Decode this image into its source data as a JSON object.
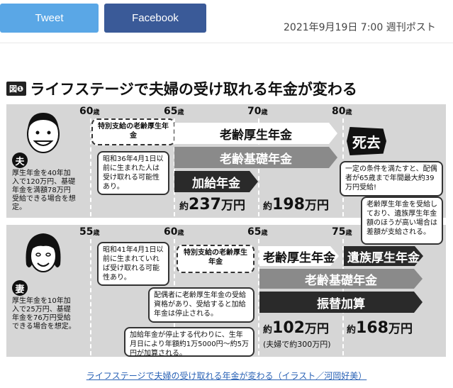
{
  "share": {
    "tweet_label": "Tweet",
    "facebook_label": "Facebook"
  },
  "meta": {
    "date": "2021年9月19日 7:00",
    "source": "週刊ポスト"
  },
  "figure": {
    "number": "図❶",
    "title": "ライフステージで夫婦の受け取れる年金が変わる",
    "husband": {
      "badge": "夫",
      "description": "厚生年金を40年加入で120万円、基礎年金を満額78万円受給できる場合を想定。",
      "ages": [
        "60",
        "65",
        "70",
        "80"
      ],
      "age_unit": "歳",
      "special_pension": "特別支給の老齢厚生年金",
      "note_special": "昭和36年4月1日以前に生まれた人は受け取れる可能性あり。",
      "bars": {
        "kousei": "老齢厚生年金",
        "kiso": "老齢基礎年金",
        "kakyu": "加給年金"
      },
      "death": "死去",
      "note_death": "一定の条件を満たすと、配偶者が65歳まで年間最大約39万円受給!",
      "amounts": [
        {
          "pre": "約",
          "big": "237",
          "unit": "万円"
        },
        {
          "pre": "約",
          "big": "198",
          "unit": "万円"
        }
      ]
    },
    "wife": {
      "badge": "妻",
      "description": "厚生年金を10年加入で25万円、基礎年金を76万円受給できる場合を想定。",
      "ages": [
        "55",
        "60",
        "65",
        "75"
      ],
      "age_unit": "歳",
      "special_pension": "特別支給の老齢厚生年金",
      "note_special": "昭和41年4月1日以前に生まれていれば受け取れる可能性あり。",
      "note_suspend": "配偶者に老齢厚生年金の受給資格があり、受給すると加給年金は停止される。",
      "note_furikae": "加給年金が停止する代わりに、生年月日により年額約1万5000円～約5万円が加算される。",
      "note_survivor": "老齢厚生年金を受給しており、遺族厚生年金額のほうが高い場合は差額が支給される。",
      "bars": {
        "kousei": "老齢厚生年金",
        "izoku": "遺族厚生年金",
        "kiso": "老齢基礎年金",
        "furikae": "振替加算"
      },
      "amounts": [
        {
          "pre": "約",
          "big": "102",
          "unit": "万円"
        },
        {
          "pre": "約",
          "big": "168",
          "unit": "万円"
        }
      ],
      "couple_total": "(夫婦で約300万円)"
    }
  },
  "caption": "ライフステージで夫婦の受け取れる年金が変わる（イラスト／河岡好美）"
}
